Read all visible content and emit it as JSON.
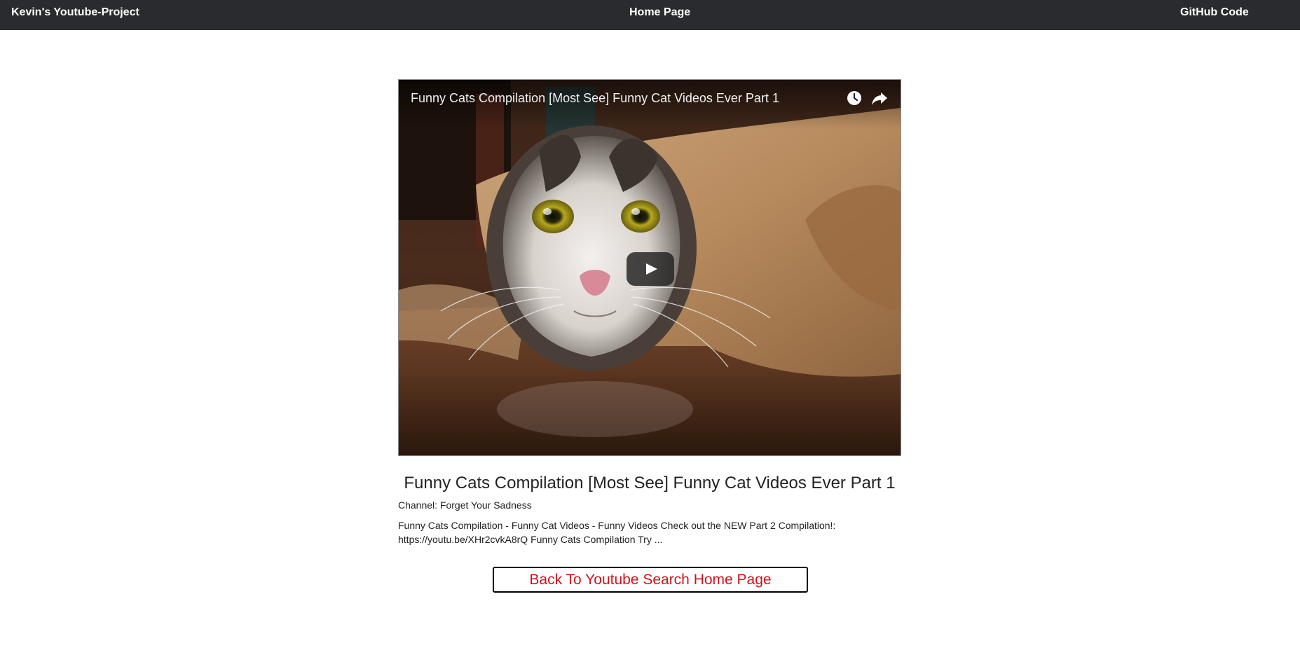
{
  "navbar": {
    "brand": "Kevin's Youtube-Project",
    "home": "Home Page",
    "github": "GitHub Code",
    "background": "#292b2e"
  },
  "player": {
    "title": "Funny Cats Compilation [Most See] Funny Cat Videos Ever Part 1",
    "thumbnail_icon": "cat-thumbnail",
    "icons": [
      "watch-later-icon",
      "share-icon",
      "play-icon"
    ]
  },
  "video": {
    "title": "Funny Cats Compilation [Most See] Funny Cat Videos Ever Part 1",
    "channel": "Channel: Forget Your Sadness",
    "description": "Funny Cats Compilation - Funny Cat Videos - Funny Videos Check out the NEW Part 2 Compilation!: https://youtu.be/XHr2cvkA8rQ Funny Cats Compilation Try ..."
  },
  "back_button": {
    "label": "Back To Youtube Search Home Page",
    "color": "#d0121b"
  }
}
